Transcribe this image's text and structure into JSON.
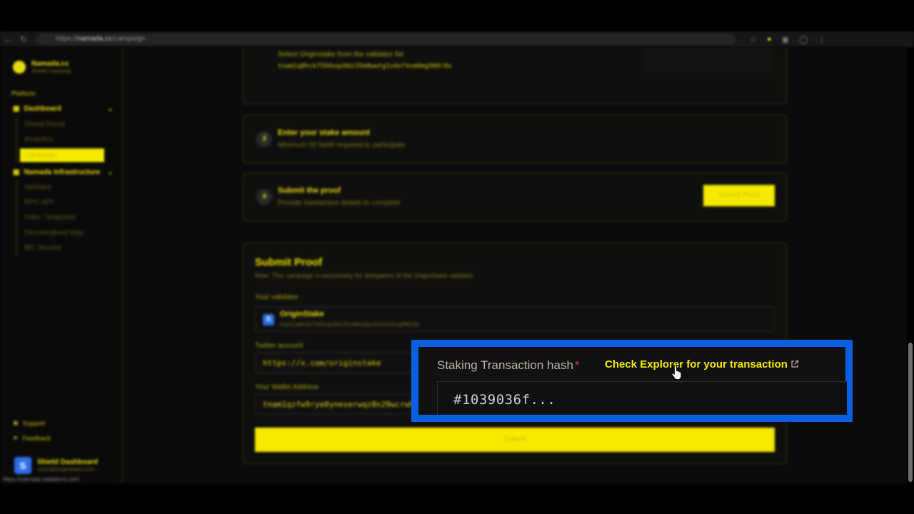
{
  "browser": {
    "url_prefix": "https://",
    "url_host": "namada.cc",
    "url_path": "/campaign"
  },
  "sidebar": {
    "brand_name": "Namada.cc",
    "brand_sub": "Shield Gateway",
    "section_label": "Platform",
    "groups": [
      {
        "label": "Dashboard",
        "items": [
          "Shield Portal",
          "Analytics",
          "Campaign"
        ]
      },
      {
        "label": "Namada Infrastructure",
        "items": [
          "Validator",
          "RPC-API",
          "Data / Snapshot",
          "Decentralized Map",
          "IBC Monitor"
        ]
      }
    ],
    "active_item": "Campaign",
    "footer": [
      "Support",
      "Feedback"
    ],
    "user": {
      "avatar": "S",
      "name": "Shield Dashboard",
      "email": "soon@originstake.com"
    }
  },
  "status_bar": "https://namada.validators.com",
  "steps": [
    {
      "title": "",
      "desc": "Select Originstake from the validator list",
      "hash": "tnam1q8hck7594xqu9dz35m8wwtg1vdxf4xm0mg980r8x"
    },
    {
      "num": "3",
      "title": "Enter your stake amount",
      "desc": "Minimum 50 NAM required to participate"
    },
    {
      "num": "4",
      "title": "Submit the proof",
      "desc": "Provide transaction details to complete",
      "button": "Submit Proof"
    }
  ],
  "form": {
    "title": "Submit Proof",
    "note": "Note: This campaign is exclusively for delegators of the OriginStake validator.",
    "validator_label": "Your validator",
    "validator_badge": "S",
    "validator_name": "OriginStake",
    "validator_address": "tnam1q8hck7594xqu9dz35m8wwtgvdxf4xm0mg980r8x",
    "twitter_label": "Twitter account",
    "twitter_value": "https://x.com/originstake",
    "wallet_label": "Your Wallet Address",
    "wallet_value": "tnam1qzfw9rye0yneserwqz8n29wcrwh",
    "submit_label": "Submit"
  },
  "zoom": {
    "label": "Staking Transaction hash",
    "required_mark": "*",
    "link_text": "Check Explorer for your transaction",
    "link_icon": "external-link-icon",
    "input_value": "#1039036f..."
  },
  "colors": {
    "accent": "#f6ea00",
    "callout_border": "#0a5ee0",
    "background": "#0b0b0b"
  }
}
